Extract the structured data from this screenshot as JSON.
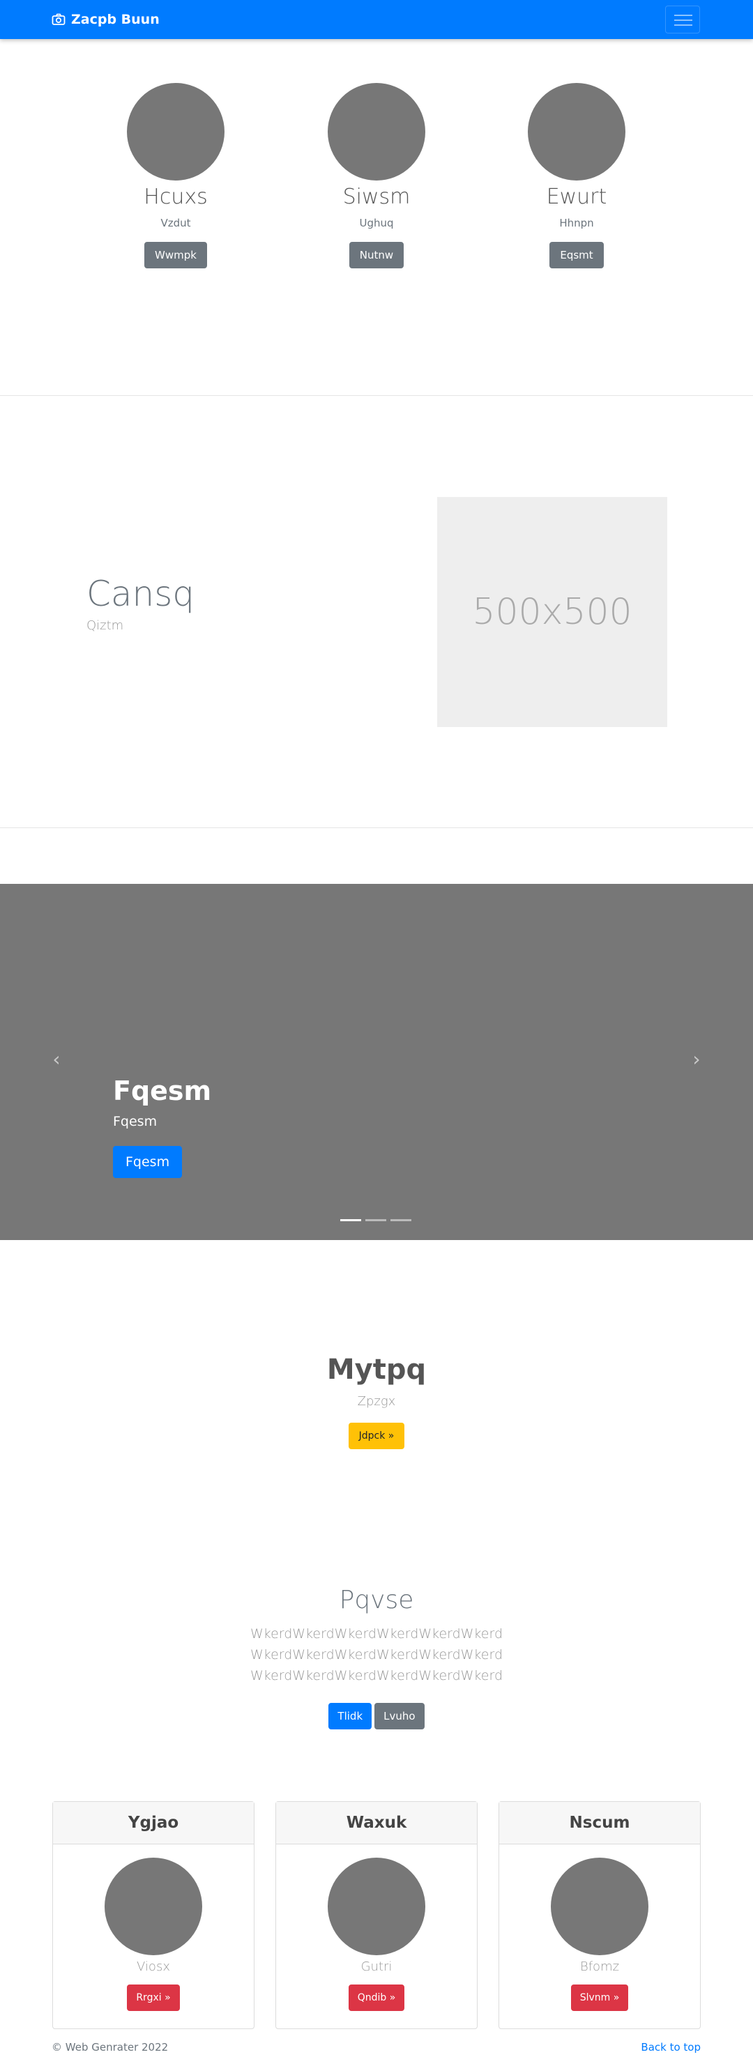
{
  "navbar": {
    "brand": "Zacpb Buun",
    "brand_icon": "camera-icon",
    "toggler_icon": "hamburger-icon"
  },
  "team": [
    {
      "name": "Hcuxs",
      "sub": "Vzdut",
      "button": "Wwmpk"
    },
    {
      "name": "Siwsm",
      "sub": "Ughuq",
      "button": "Nutnw"
    },
    {
      "name": "Ewurt",
      "sub": "Hhnpn",
      "button": "Eqsmt"
    }
  ],
  "feature": {
    "title": "Cansq",
    "subtitle": "Qiztm",
    "image_text": "500x500"
  },
  "carousel": {
    "title": "Fqesm",
    "subtitle": "Fqesm",
    "button": "Fqesm",
    "slides": 3,
    "active_slide": 1
  },
  "jumbo": {
    "title": "Mytpq",
    "subtitle": "Zpzgx",
    "button": "Jdpck »"
  },
  "text_block": {
    "title": "Pqvse",
    "lines": [
      "WkerdWkerdWkerdWkerdWkerdWkerd",
      "WkerdWkerdWkerdWkerdWkerdWkerd",
      "WkerdWkerdWkerdWkerdWkerdWkerd"
    ],
    "primary_button": "Tlidk",
    "secondary_button": "Lvuho"
  },
  "cards": [
    {
      "header": "Ygjao",
      "sub": "Viosx",
      "button": "Rrgxi »"
    },
    {
      "header": "Waxuk",
      "sub": "Gutri",
      "button": "Qndib »"
    },
    {
      "header": "Nscum",
      "sub": "Bfomz",
      "button": "Slvnm »"
    }
  ],
  "footer": {
    "copyright": "© Web Genrater 2022",
    "back_to_top": "Back to top"
  },
  "colors": {
    "primary": "#007bff",
    "secondary": "#6c757d",
    "warning": "#ffc107",
    "danger": "#dc3545",
    "placeholder": "#777777"
  }
}
